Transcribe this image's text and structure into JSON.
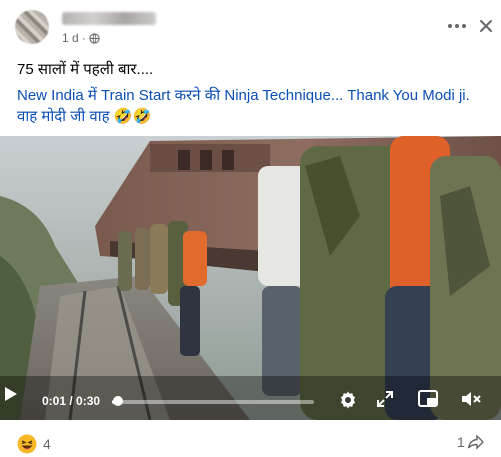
{
  "header": {
    "meta": "1 d",
    "meta_dot": "·",
    "more_icon": "more-horizontal-icon",
    "close_icon": "close-icon"
  },
  "post": {
    "line1": "75 सालों में पहली बार....",
    "line2": "New India में Train Start करने की Ninja Technique... Thank You Modi ji.",
    "line3": "वाह मोदी जी वाह 🤣🤣"
  },
  "video": {
    "time_label": "0:01 / 0:30",
    "progress": 0.03,
    "icons": [
      "play-icon",
      "settings-icon",
      "expand-icon",
      "fullscreen-icon",
      "picture-in-picture-icon",
      "volume-muted-icon"
    ]
  },
  "footer": {
    "reaction_icon": "haha-emoji-icon",
    "reaction_count": "4",
    "share_count": "1",
    "share_icon": "share-arrow-icon"
  },
  "colors": {
    "link_blue": "#0b4fb5",
    "meta_grey": "#65676b",
    "haha_yellow": "#f7b928"
  }
}
